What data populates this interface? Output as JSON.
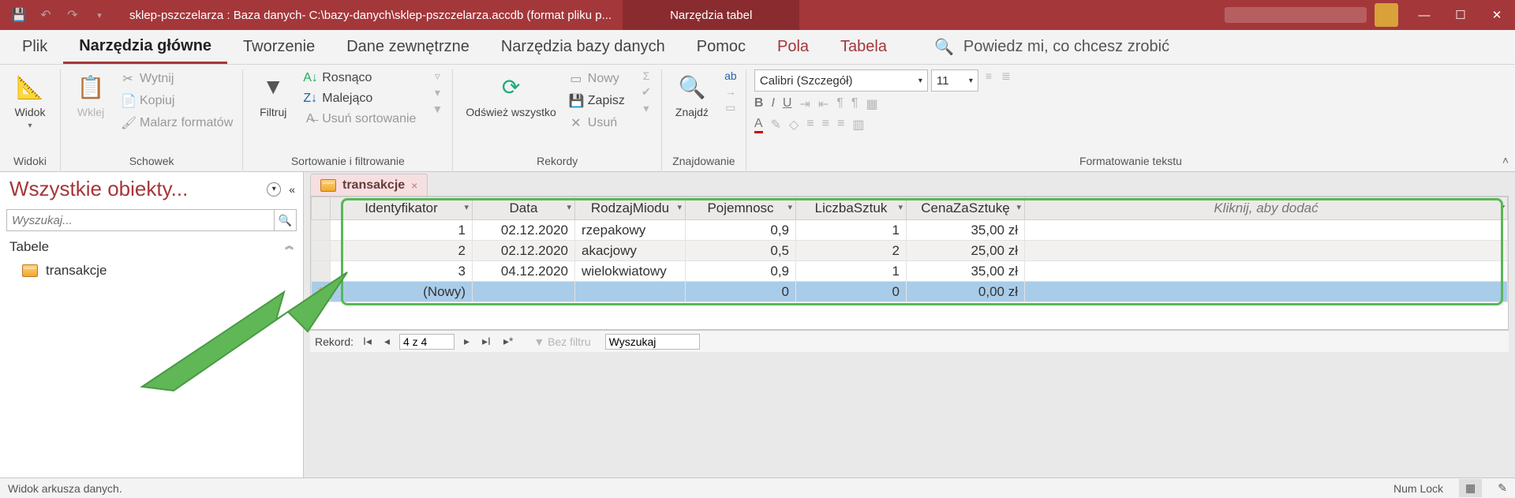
{
  "titlebar": {
    "title": "sklep-pszczelarza : Baza danych- C:\\bazy-danych\\sklep-pszczelarza.accdb (format pliku p...",
    "contextual": "Narzędzia tabel"
  },
  "tabs": {
    "file": "Plik",
    "home": "Narzędzia główne",
    "create": "Tworzenie",
    "external": "Dane zewnętrzne",
    "dbtools": "Narzędzia bazy danych",
    "help": "Pomoc",
    "fields": "Pola",
    "table": "Tabela",
    "tellme": "Powiedz mi, co chcesz zrobić"
  },
  "ribbon": {
    "views_group": "Widoki",
    "view": "Widok",
    "clipboard_group": "Schowek",
    "paste": "Wklej",
    "cut": "Wytnij",
    "copy": "Kopiuj",
    "painter": "Malarz formatów",
    "sortfilter_group": "Sortowanie i filtrowanie",
    "filter": "Filtruj",
    "asc": "Rosnąco",
    "desc": "Malejąco",
    "clearsort": "Usuń sortowanie",
    "records_group": "Rekordy",
    "refresh": "Odśwież wszystko",
    "new": "Nowy",
    "save": "Zapisz",
    "delete": "Usuń",
    "find_group": "Znajdowanie",
    "find": "Znajdź",
    "textfmt_group": "Formatowanie tekstu",
    "font": "Calibri (Szczegół)",
    "size": "11"
  },
  "nav": {
    "title": "Wszystkie obiekty...",
    "search_ph": "Wyszukaj...",
    "group": "Tabele",
    "item1": "transakcje"
  },
  "doc": {
    "tab": "transakcje",
    "addcol": "Kliknij, aby dodać"
  },
  "cols": {
    "id": "Identyfikator",
    "date": "Data",
    "kind": "RodzajMiodu",
    "cap": "Pojemnosc",
    "qty": "LiczbaSztuk",
    "price": "CenaZaSztukę"
  },
  "rows": [
    {
      "id": "1",
      "date": "02.12.2020",
      "kind": "rzepakowy",
      "cap": "0,9",
      "qty": "1",
      "price": "35,00 zł"
    },
    {
      "id": "2",
      "date": "02.12.2020",
      "kind": "akacjowy",
      "cap": "0,5",
      "qty": "2",
      "price": "25,00 zł"
    },
    {
      "id": "3",
      "date": "04.12.2020",
      "kind": "wielokwiatowy",
      "cap": "0,9",
      "qty": "1",
      "price": "35,00 zł"
    }
  ],
  "newrow": {
    "id": "(Nowy)",
    "cap": "0",
    "qty": "0",
    "price": "0,00 zł"
  },
  "recnav": {
    "label": "Rekord:",
    "pos": "4 z 4",
    "nofilter": "Bez filtru",
    "search": "Wyszukaj"
  },
  "status": {
    "left": "Widok arkusza danych.",
    "numlock": "Num Lock"
  }
}
